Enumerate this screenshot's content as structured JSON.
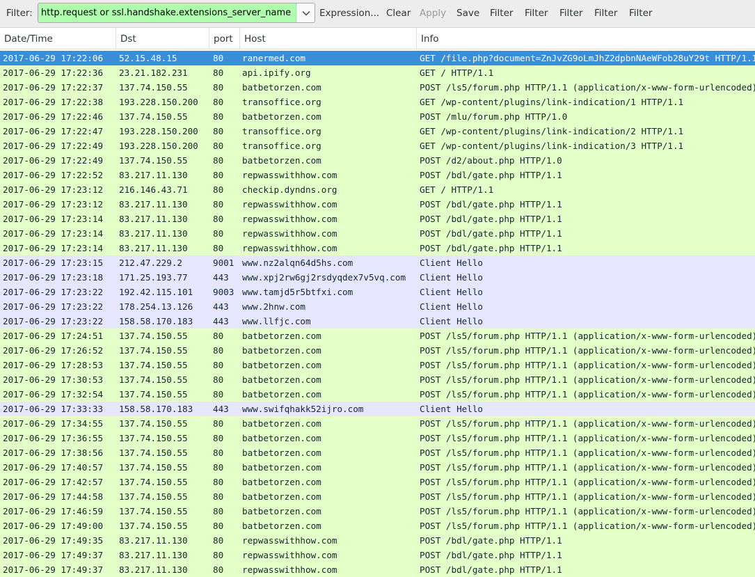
{
  "toolbar": {
    "filter_label": "Filter:",
    "filter_value": "http.request or ssl.handshake.extensions_server_name",
    "buttons": [
      {
        "label": "Expression...",
        "enabled": true
      },
      {
        "label": "Clear",
        "enabled": true
      },
      {
        "label": "Apply",
        "enabled": false
      },
      {
        "label": "Save",
        "enabled": true
      },
      {
        "label": "Filter",
        "enabled": true
      },
      {
        "label": "Filter",
        "enabled": true
      },
      {
        "label": "Filter",
        "enabled": true
      },
      {
        "label": "Filter",
        "enabled": true
      },
      {
        "label": "Filter",
        "enabled": true
      }
    ],
    "dropdown_icon": "chevron-down-icon"
  },
  "columns": [
    "Date/Time",
    "Dst",
    "port",
    "Host",
    "Info"
  ],
  "colors": {
    "http_row": "#e4ffc7",
    "tls_row": "#e7e6ff",
    "selected_row": "#3a8ed8",
    "filter_valid": "#afffaf"
  },
  "rows": [
    {
      "time": "2017-06-29 17:22:06",
      "dst": "52.15.48.15",
      "port": "80",
      "host": "ranermed.com",
      "info": "GET /file.php?document=ZnJvZG9oLmJhZ2dpbnNAeWFob28uY29t HTTP/1.1",
      "type": "http",
      "selected": true
    },
    {
      "time": "2017-06-29 17:22:36",
      "dst": "23.21.182.231",
      "port": "80",
      "host": "api.ipify.org",
      "info": "GET / HTTP/1.1",
      "type": "http"
    },
    {
      "time": "2017-06-29 17:22:37",
      "dst": "137.74.150.55",
      "port": "80",
      "host": "batbetorzen.com",
      "info": "POST /ls5/forum.php HTTP/1.1  (application/x-www-form-urlencoded)",
      "type": "http"
    },
    {
      "time": "2017-06-29 17:22:38",
      "dst": "193.228.150.200",
      "port": "80",
      "host": "transoffice.org",
      "info": "GET /wp-content/plugins/link-indication/1 HTTP/1.1",
      "type": "http"
    },
    {
      "time": "2017-06-29 17:22:46",
      "dst": "137.74.150.55",
      "port": "80",
      "host": "batbetorzen.com",
      "info": "POST /mlu/forum.php HTTP/1.0",
      "type": "http"
    },
    {
      "time": "2017-06-29 17:22:47",
      "dst": "193.228.150.200",
      "port": "80",
      "host": "transoffice.org",
      "info": "GET /wp-content/plugins/link-indication/2 HTTP/1.1",
      "type": "http"
    },
    {
      "time": "2017-06-29 17:22:49",
      "dst": "193.228.150.200",
      "port": "80",
      "host": "transoffice.org",
      "info": "GET /wp-content/plugins/link-indication/3 HTTP/1.1",
      "type": "http"
    },
    {
      "time": "2017-06-29 17:22:49",
      "dst": "137.74.150.55",
      "port": "80",
      "host": "batbetorzen.com",
      "info": "POST /d2/about.php HTTP/1.0",
      "type": "http"
    },
    {
      "time": "2017-06-29 17:22:52",
      "dst": "83.217.11.130",
      "port": "80",
      "host": "repwasswithhow.com",
      "info": "POST /bdl/gate.php HTTP/1.1",
      "type": "http"
    },
    {
      "time": "2017-06-29 17:23:12",
      "dst": "216.146.43.71",
      "port": "80",
      "host": "checkip.dyndns.org",
      "info": "GET / HTTP/1.1",
      "type": "http"
    },
    {
      "time": "2017-06-29 17:23:12",
      "dst": "83.217.11.130",
      "port": "80",
      "host": "repwasswithhow.com",
      "info": "POST /bdl/gate.php HTTP/1.1",
      "type": "http"
    },
    {
      "time": "2017-06-29 17:23:14",
      "dst": "83.217.11.130",
      "port": "80",
      "host": "repwasswithhow.com",
      "info": "POST /bdl/gate.php HTTP/1.1",
      "type": "http"
    },
    {
      "time": "2017-06-29 17:23:14",
      "dst": "83.217.11.130",
      "port": "80",
      "host": "repwasswithhow.com",
      "info": "POST /bdl/gate.php HTTP/1.1",
      "type": "http"
    },
    {
      "time": "2017-06-29 17:23:14",
      "dst": "83.217.11.130",
      "port": "80",
      "host": "repwasswithhow.com",
      "info": "POST /bdl/gate.php HTTP/1.1",
      "type": "http"
    },
    {
      "time": "2017-06-29 17:23:15",
      "dst": "212.47.229.2",
      "port": "9001",
      "host": "www.nz2alqn64d5hs.com",
      "info": "Client Hello",
      "type": "tls"
    },
    {
      "time": "2017-06-29 17:23:18",
      "dst": "171.25.193.77",
      "port": "443",
      "host": "www.xpj2rw6gj2rsdyqdex7v5vq.com",
      "info": "Client Hello",
      "type": "tls"
    },
    {
      "time": "2017-06-29 17:23:22",
      "dst": "192.42.115.101",
      "port": "9003",
      "host": "www.tamjd5r5btfxi.com",
      "info": "Client Hello",
      "type": "tls"
    },
    {
      "time": "2017-06-29 17:23:22",
      "dst": "178.254.13.126",
      "port": "443",
      "host": "www.2hnw.com",
      "info": "Client Hello",
      "type": "tls"
    },
    {
      "time": "2017-06-29 17:23:22",
      "dst": "158.58.170.183",
      "port": "443",
      "host": "www.llfjc.com",
      "info": "Client Hello",
      "type": "tls"
    },
    {
      "time": "2017-06-29 17:24:51",
      "dst": "137.74.150.55",
      "port": "80",
      "host": "batbetorzen.com",
      "info": "POST /ls5/forum.php HTTP/1.1  (application/x-www-form-urlencoded)",
      "type": "http"
    },
    {
      "time": "2017-06-29 17:26:52",
      "dst": "137.74.150.55",
      "port": "80",
      "host": "batbetorzen.com",
      "info": "POST /ls5/forum.php HTTP/1.1  (application/x-www-form-urlencoded)",
      "type": "http"
    },
    {
      "time": "2017-06-29 17:28:53",
      "dst": "137.74.150.55",
      "port": "80",
      "host": "batbetorzen.com",
      "info": "POST /ls5/forum.php HTTP/1.1  (application/x-www-form-urlencoded)",
      "type": "http"
    },
    {
      "time": "2017-06-29 17:30:53",
      "dst": "137.74.150.55",
      "port": "80",
      "host": "batbetorzen.com",
      "info": "POST /ls5/forum.php HTTP/1.1  (application/x-www-form-urlencoded)",
      "type": "http"
    },
    {
      "time": "2017-06-29 17:32:54",
      "dst": "137.74.150.55",
      "port": "80",
      "host": "batbetorzen.com",
      "info": "POST /ls5/forum.php HTTP/1.1  (application/x-www-form-urlencoded)",
      "type": "http"
    },
    {
      "time": "2017-06-29 17:33:33",
      "dst": "158.58.170.183",
      "port": "443",
      "host": "www.swifqhakk52ijro.com",
      "info": "Client Hello",
      "type": "tls"
    },
    {
      "time": "2017-06-29 17:34:55",
      "dst": "137.74.150.55",
      "port": "80",
      "host": "batbetorzen.com",
      "info": "POST /ls5/forum.php HTTP/1.1  (application/x-www-form-urlencoded)",
      "type": "http"
    },
    {
      "time": "2017-06-29 17:36:55",
      "dst": "137.74.150.55",
      "port": "80",
      "host": "batbetorzen.com",
      "info": "POST /ls5/forum.php HTTP/1.1  (application/x-www-form-urlencoded)",
      "type": "http"
    },
    {
      "time": "2017-06-29 17:38:56",
      "dst": "137.74.150.55",
      "port": "80",
      "host": "batbetorzen.com",
      "info": "POST /ls5/forum.php HTTP/1.1  (application/x-www-form-urlencoded)",
      "type": "http"
    },
    {
      "time": "2017-06-29 17:40:57",
      "dst": "137.74.150.55",
      "port": "80",
      "host": "batbetorzen.com",
      "info": "POST /ls5/forum.php HTTP/1.1  (application/x-www-form-urlencoded)",
      "type": "http"
    },
    {
      "time": "2017-06-29 17:42:57",
      "dst": "137.74.150.55",
      "port": "80",
      "host": "batbetorzen.com",
      "info": "POST /ls5/forum.php HTTP/1.1  (application/x-www-form-urlencoded)",
      "type": "http"
    },
    {
      "time": "2017-06-29 17:44:58",
      "dst": "137.74.150.55",
      "port": "80",
      "host": "batbetorzen.com",
      "info": "POST /ls5/forum.php HTTP/1.1  (application/x-www-form-urlencoded)",
      "type": "http"
    },
    {
      "time": "2017-06-29 17:46:59",
      "dst": "137.74.150.55",
      "port": "80",
      "host": "batbetorzen.com",
      "info": "POST /ls5/forum.php HTTP/1.1  (application/x-www-form-urlencoded)",
      "type": "http"
    },
    {
      "time": "2017-06-29 17:49:00",
      "dst": "137.74.150.55",
      "port": "80",
      "host": "batbetorzen.com",
      "info": "POST /ls5/forum.php HTTP/1.1  (application/x-www-form-urlencoded)",
      "type": "http"
    },
    {
      "time": "2017-06-29 17:49:35",
      "dst": "83.217.11.130",
      "port": "80",
      "host": "repwasswithhow.com",
      "info": "POST /bdl/gate.php HTTP/1.1",
      "type": "http"
    },
    {
      "time": "2017-06-29 17:49:37",
      "dst": "83.217.11.130",
      "port": "80",
      "host": "repwasswithhow.com",
      "info": "POST /bdl/gate.php HTTP/1.1",
      "type": "http"
    },
    {
      "time": "2017-06-29 17:49:37",
      "dst": "83.217.11.130",
      "port": "80",
      "host": "repwasswithhow.com",
      "info": "POST /bdl/gate.php HTTP/1.1",
      "type": "http"
    }
  ]
}
